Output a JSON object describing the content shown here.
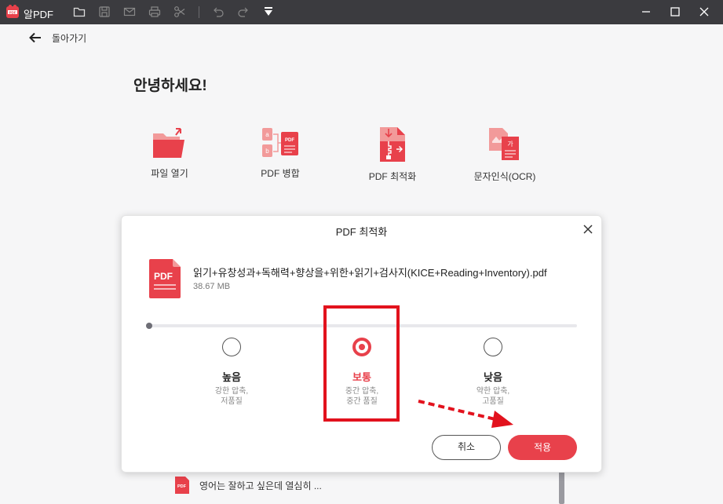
{
  "titlebar": {
    "app_name": "알PDF",
    "icons": [
      "open-folder-icon",
      "save-icon",
      "mail-icon",
      "print-icon",
      "scissors-icon",
      "undo-icon",
      "redo-icon",
      "dropdown-icon"
    ],
    "window_controls": [
      "minimize-icon",
      "maximize-icon",
      "close-icon"
    ]
  },
  "nav": {
    "back_label": "돌아가기"
  },
  "home": {
    "greeting": "안녕하세요!",
    "tools": [
      {
        "label": "파일 열기",
        "icon": "folder-open-icon"
      },
      {
        "label": "PDF 병합",
        "icon": "pdf-merge-icon"
      },
      {
        "label": "PDF 최적화",
        "icon": "pdf-optimize-icon"
      },
      {
        "label": "문자인식(OCR)",
        "icon": "ocr-icon"
      }
    ],
    "recent_file": "영어는 잘하고 싶은데 열심히 ..."
  },
  "dialog": {
    "title": "PDF 최적화",
    "file_badge": "PDF",
    "file_name": "읽기+유창성과+독해력+향상을+위한+읽기+검사지(KICE+Reading+Inventory).pdf",
    "file_size": "38.67 MB",
    "options": [
      {
        "title": "높음",
        "desc1": "강한 압축,",
        "desc2": "저품질",
        "selected": false
      },
      {
        "title": "보통",
        "desc1": "중간 압축,",
        "desc2": "중간 품질",
        "selected": true
      },
      {
        "title": "낮음",
        "desc1": "약한 압축,",
        "desc2": "고품질",
        "selected": false
      }
    ],
    "cancel_label": "취소",
    "apply_label": "적용"
  },
  "colors": {
    "accent": "#e8414b",
    "titlebar": "#3b3b3f",
    "annotation": "#e2121d"
  }
}
